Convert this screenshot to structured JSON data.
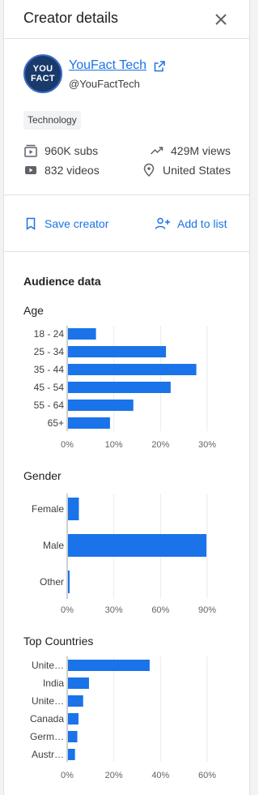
{
  "header": {
    "title": "Creator details"
  },
  "creator": {
    "avatar_line1": "YOU",
    "avatar_line2": "FACT",
    "name": "YouFact Tech",
    "handle": "@YouFactTech",
    "category": "Technology"
  },
  "stats": {
    "subs": "960K subs",
    "views": "429M views",
    "videos": "832 videos",
    "location": "United States"
  },
  "actions": {
    "save_label": "Save creator",
    "add_label": "Add to list"
  },
  "audience": {
    "title": "Audience data"
  },
  "colors": {
    "bar": "#1a73e8",
    "link": "#1a73e8",
    "grid": "#e8eaed"
  },
  "chart_data": [
    {
      "type": "bar",
      "orientation": "horizontal",
      "title": "Age",
      "categories": [
        "18 - 24",
        "25 - 34",
        "35 - 44",
        "45 - 54",
        "55 - 64",
        "65+"
      ],
      "values": [
        6,
        21,
        27.5,
        22,
        14,
        9
      ],
      "xlim": [
        0,
        30
      ],
      "xticks": [
        "0%",
        "10%",
        "20%",
        "30%"
      ],
      "tick_values": [
        0,
        10,
        20,
        30
      ]
    },
    {
      "type": "bar",
      "orientation": "horizontal",
      "title": "Gender",
      "categories": [
        "Female",
        "Male",
        "Other"
      ],
      "values": [
        7,
        89,
        1
      ],
      "xlim": [
        0,
        90
      ],
      "xticks": [
        "0%",
        "30%",
        "60%",
        "90%"
      ],
      "tick_values": [
        0,
        30,
        60,
        90
      ]
    },
    {
      "type": "bar",
      "orientation": "horizontal",
      "title": "Top Countries",
      "categories": [
        "Unite…",
        "India",
        "Unite…",
        "Canada",
        "Germ…",
        "Austr…"
      ],
      "values": [
        35,
        9,
        6.5,
        4.5,
        4,
        3
      ],
      "xlim": [
        0,
        60
      ],
      "xticks": [
        "0%",
        "20%",
        "40%",
        "60%"
      ],
      "tick_values": [
        0,
        20,
        40,
        60
      ]
    }
  ]
}
